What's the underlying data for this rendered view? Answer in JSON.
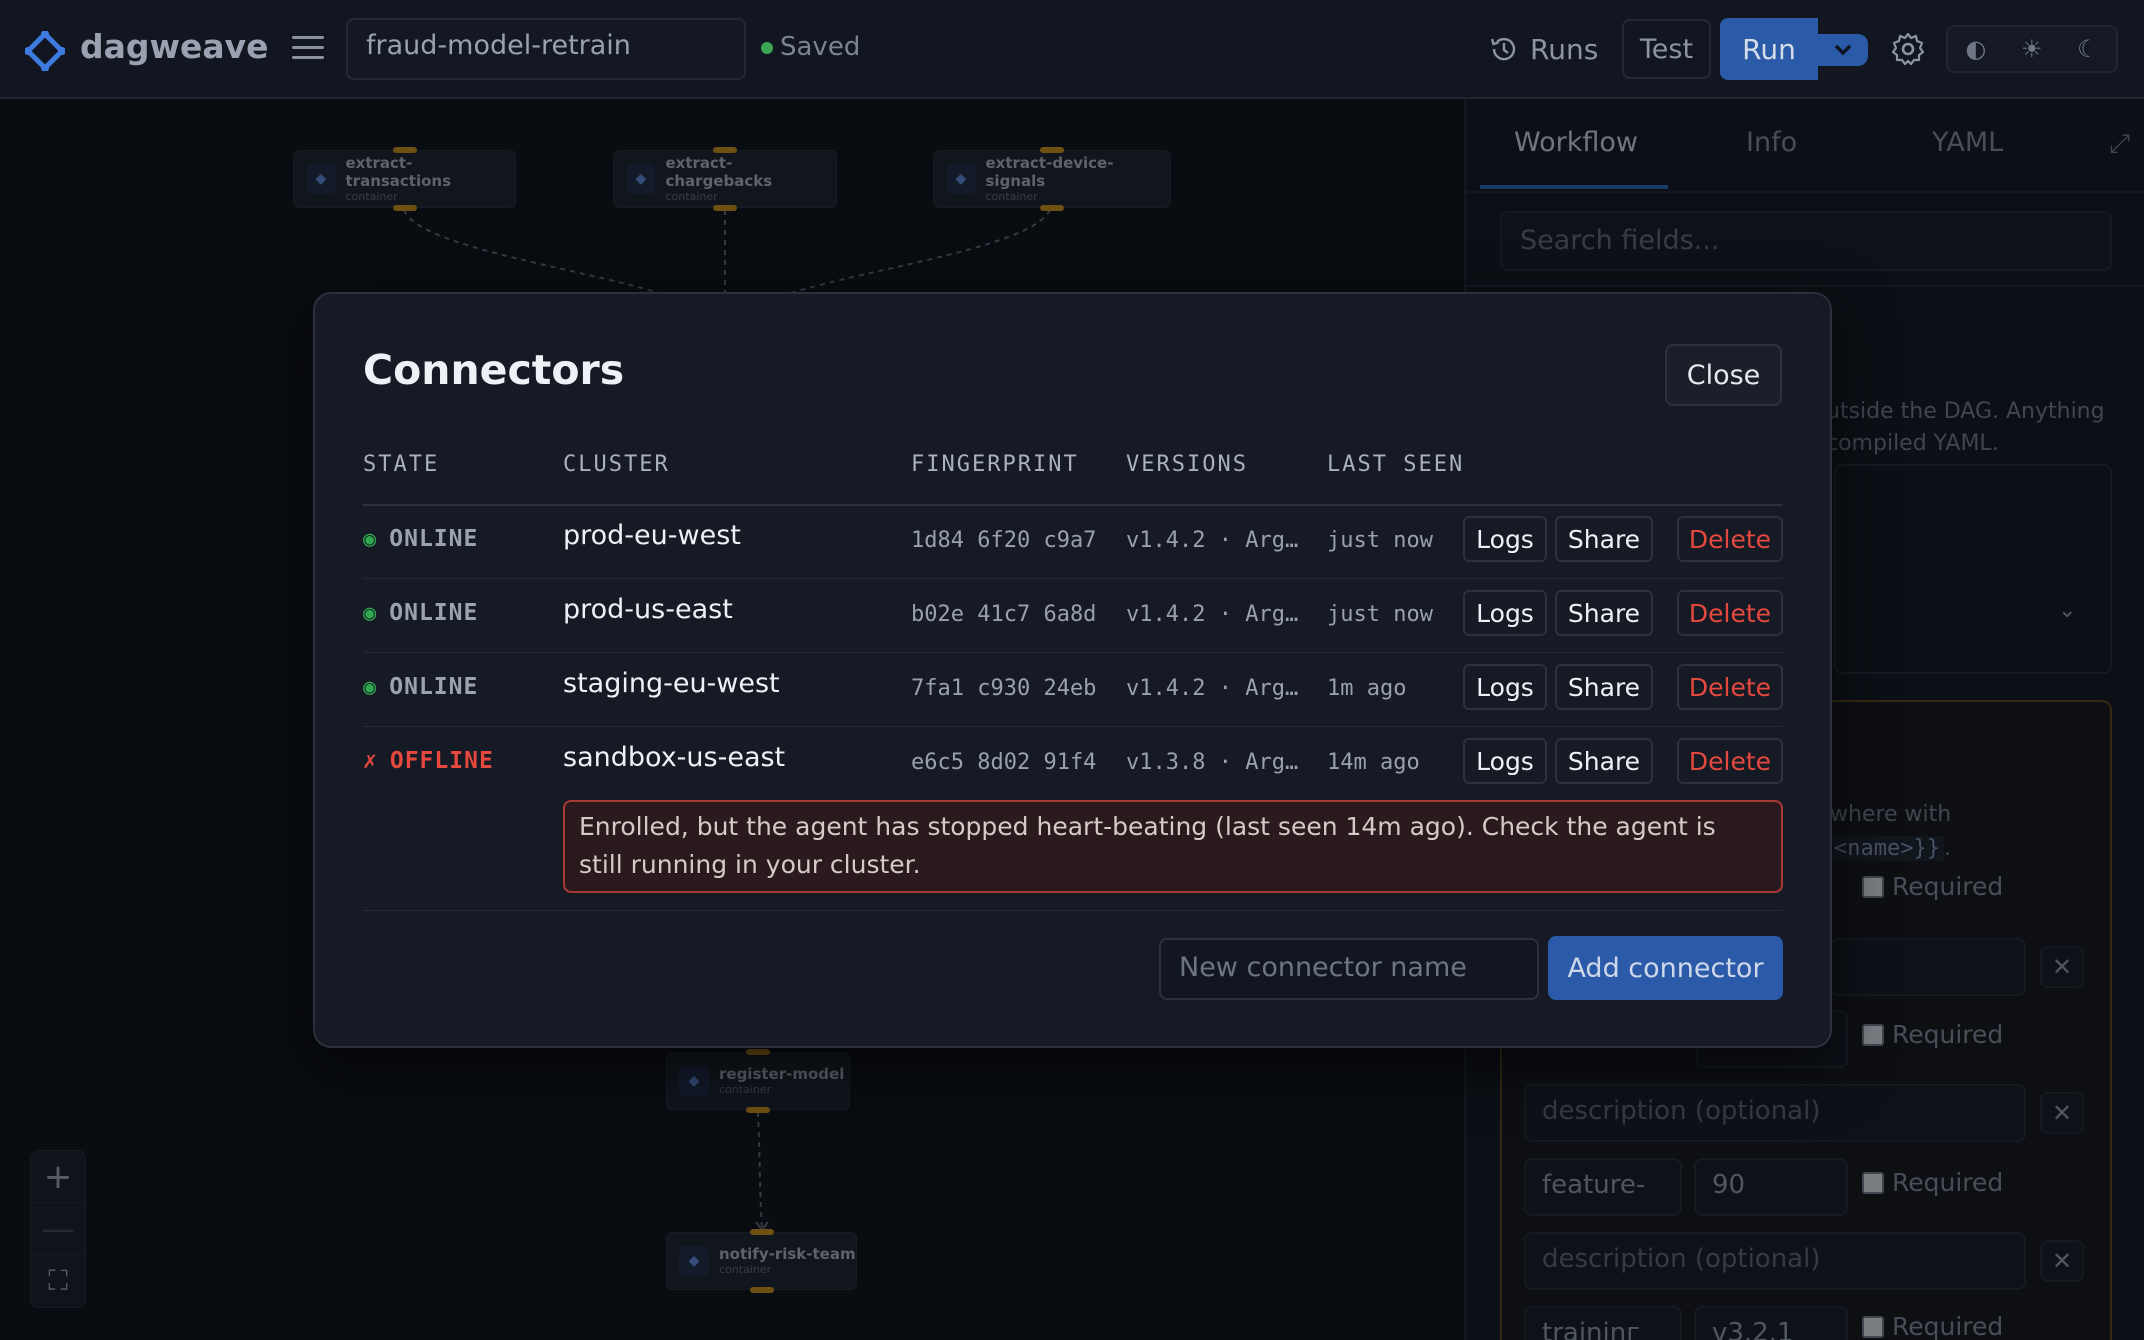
{
  "app": {
    "brand": "dagweave",
    "workflow_name": "fraud-model-retrain",
    "save_status": "Saved"
  },
  "toolbar": {
    "runs_label": "Runs",
    "test_label": "Test",
    "run_label": "Run",
    "theme_icons": [
      "◐",
      "☀",
      "☾"
    ]
  },
  "canvas": {
    "nodes": [
      {
        "title": "extract-transactions",
        "kind": "container"
      },
      {
        "title": "extract-chargebacks",
        "kind": "container"
      },
      {
        "title": "extract-device-signals",
        "kind": "container"
      },
      {
        "title": "register-model",
        "kind": "container"
      },
      {
        "title": "notify-risk-team",
        "kind": "container"
      }
    ],
    "zoom": {
      "in": "+",
      "out": "—",
      "fit": "⛶"
    }
  },
  "panel": {
    "tabs": [
      "Workflow",
      "Info",
      "YAML"
    ],
    "active_tab": "Workflow",
    "search_placeholder": "Search fields...",
    "help_line1": "utside the DAG. Anything",
    "help_line2": "compiled YAML.",
    "param_help_line1": "where with",
    "param_help_code": "<name>}}",
    "param_help_end": ".",
    "required_label": "Required",
    "desc_placeholder": "description (optional)",
    "params": [
      {
        "name": "feature-",
        "value": "90"
      },
      {
        "name": "traininг",
        "value": "v3.2.1"
      }
    ],
    "partial_value": "-"
  },
  "modal": {
    "title": "Connectors",
    "close_label": "Close",
    "columns": [
      "STATE",
      "CLUSTER",
      "FINGERPRINT",
      "VERSIONS",
      "LAST SEEN"
    ],
    "rows": [
      {
        "state": "ONLINE",
        "state_icon": "◉",
        "cluster": "prod-eu-west",
        "fingerprint": "1d84 6f20 c9a7",
        "versions": "v1.4.2 · Arg…",
        "last_seen": "just now"
      },
      {
        "state": "ONLINE",
        "state_icon": "◉",
        "cluster": "prod-us-east",
        "fingerprint": "b02e 41c7 6a8d",
        "versions": "v1.4.2 · Arg…",
        "last_seen": "just now"
      },
      {
        "state": "ONLINE",
        "state_icon": "◉",
        "cluster": "staging-eu-west",
        "fingerprint": "7fa1 c930 24eb",
        "versions": "v1.4.2 · Arg…",
        "last_seen": "1m ago"
      },
      {
        "state": "OFFLINE",
        "state_icon": "✗",
        "cluster": "sandbox-us-east",
        "fingerprint": "e6c5 8d02 91f4",
        "versions": "v1.3.8 · Arg…",
        "last_seen": "14m ago"
      }
    ],
    "row_actions": {
      "logs": "Logs",
      "share": "Share",
      "delete": "Delete"
    },
    "offline_message": "Enrolled, but the agent has stopped heart-beating (last seen 14m ago). Check the agent is still running in your cluster.",
    "new_connector_placeholder": "New connector name",
    "add_label": "Add connector"
  },
  "colors": {
    "accent": "#2a5aa8",
    "online": "#2fa84f",
    "offline": "#e5483e",
    "port": "#c48a1a"
  }
}
